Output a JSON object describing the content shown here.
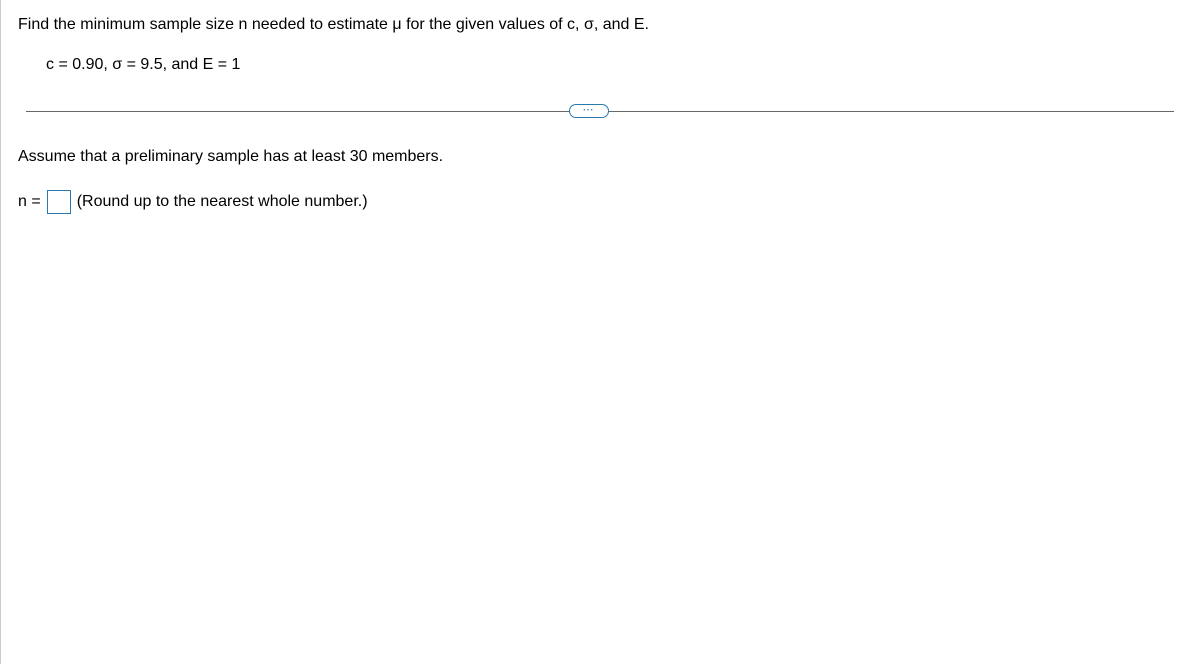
{
  "question": {
    "prompt": "Find the minimum sample size n needed to estimate μ for the given values of c, σ, and E.",
    "params": "c = 0.90, σ = 9.5, and E = 1"
  },
  "divider": {
    "dots": "⋯"
  },
  "assume_text": "Assume that a preliminary sample has at least 30 members.",
  "answer": {
    "label": "n =",
    "value": "",
    "hint": "(Round up to the nearest whole number.)"
  }
}
